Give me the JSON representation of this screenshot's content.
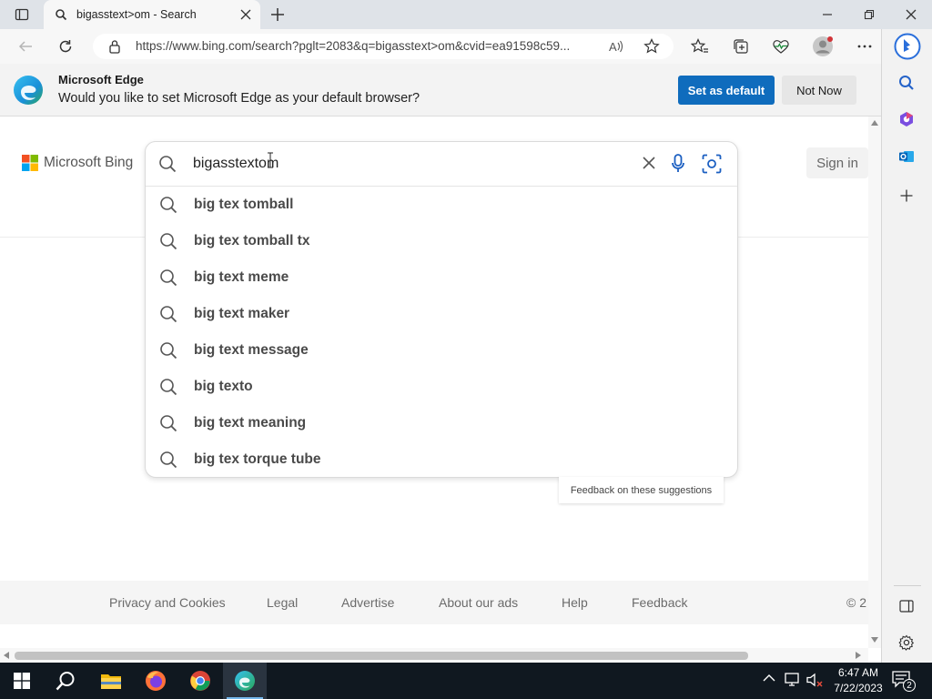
{
  "browser": {
    "tab_title": "bigasstext>om - Search",
    "url": "https://www.bing.com/search?pglt=2083&q=bigasstext>om&cvid=ea91598c59..."
  },
  "infobar": {
    "title": "Microsoft Edge",
    "message": "Would you like to set Microsoft Edge as your default browser?",
    "set_default_label": "Set as default",
    "not_now_label": "Not Now"
  },
  "bing": {
    "logo_text": "Microsoft Bing",
    "sign_in_label": "Sign in",
    "query": "bigasstextom",
    "suggestions": [
      "big tex tomball",
      "big tex tomball tx",
      "big text meme",
      "big text maker",
      "big text message",
      "big texto",
      "big text meaning",
      "big tex torque tube"
    ],
    "feedback_suggestions_label": "Feedback on these suggestions"
  },
  "footer": {
    "links": [
      "Privacy and Cookies",
      "Legal",
      "Advertise",
      "About our ads",
      "Help",
      "Feedback"
    ],
    "copyright": "© 2"
  },
  "taskbar": {
    "time": "6:47 AM",
    "date": "7/22/2023",
    "notification_count": "2"
  },
  "colors": {
    "accent": "#0f6cbd",
    "tabbar": "#dfe3e8",
    "taskbar": "#101820"
  }
}
